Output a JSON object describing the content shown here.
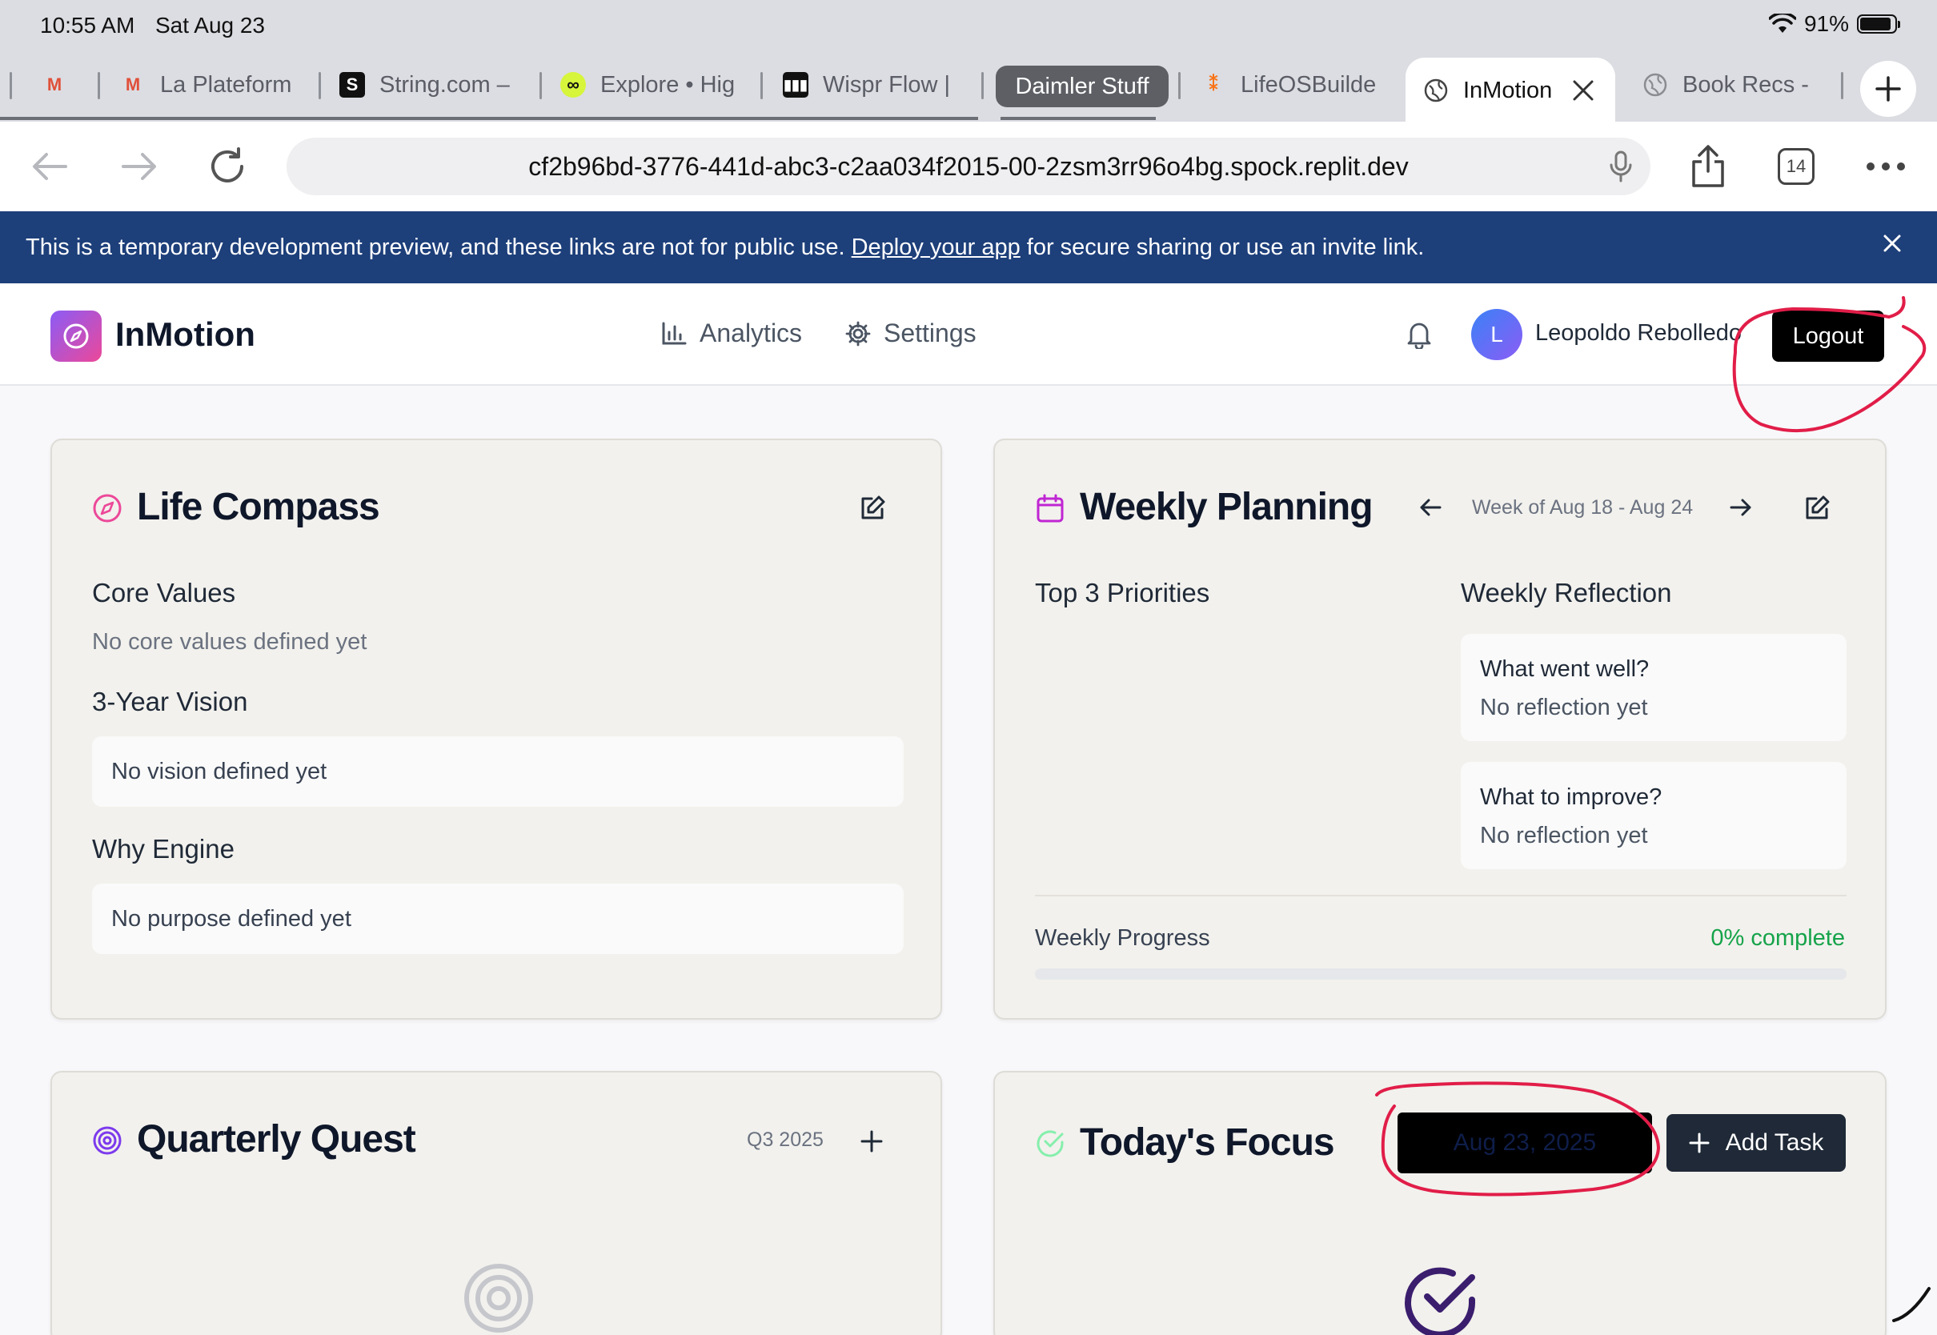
{
  "status_bar": {
    "time": "10:55 AM",
    "date": "Sat Aug 23",
    "battery": "91%",
    "battery_level": 0.91
  },
  "tabs": [
    {
      "label": "",
      "icon": "m-logo-icon"
    },
    {
      "label": "La Plateform",
      "icon": "m-logo-icon"
    },
    {
      "label": "String.com –",
      "icon": "s-logo-icon"
    },
    {
      "label": "Explore • Hig",
      "icon": "explore-logo-icon"
    },
    {
      "label": "Wispr Flow |",
      "icon": "wispr-logo-icon"
    },
    {
      "label": "LifeOSBuilde",
      "icon": "lifeos-logo-icon"
    },
    {
      "label": "InMotion",
      "icon": "globe-icon",
      "active": true
    },
    {
      "label": "Book Recs -",
      "icon": "globe-icon"
    }
  ],
  "tab_group": {
    "label": "Daimler Stuff"
  },
  "browser": {
    "url": "cf2b96bd-3776-441d-abc3-c2aa034f2015-00-2zsm3rr96o4bg.spock.replit.dev",
    "tab_count": "14"
  },
  "banner": {
    "text_before": "This is a temporary development preview, and these links are not for public use.",
    "link": "Deploy your app",
    "text_after": "for secure sharing or use an invite link."
  },
  "header": {
    "app_name": "InMotion",
    "nav": {
      "analytics": "Analytics",
      "settings": "Settings"
    },
    "avatar_initial": "L",
    "user_name": "Leopoldo Rebolledo",
    "logout": "Logout"
  },
  "life_compass": {
    "title": "Life Compass",
    "core_values_label": "Core Values",
    "core_values_empty": "No core values defined yet",
    "vision_label": "3-Year Vision",
    "vision_empty": "No vision defined yet",
    "why_label": "Why Engine",
    "why_empty": "No purpose defined yet"
  },
  "weekly_planning": {
    "title": "Weekly Planning",
    "week_range": "Week of Aug 18 - Aug 24",
    "priorities_label": "Top 3 Priorities",
    "reflection_label": "Weekly Reflection",
    "went_well_label": "What went well?",
    "went_well_text": "No reflection yet",
    "improve_label": "What to improve?",
    "improve_text": "No reflection yet",
    "progress_label": "Weekly Progress",
    "progress_text": "0% complete",
    "progress_value": 0
  },
  "quarterly_quest": {
    "title": "Quarterly Quest",
    "quarter": "Q3 2025"
  },
  "todays_focus": {
    "title": "Today's Focus",
    "date": "Aug 23, 2025",
    "add_task": "Add Task"
  },
  "colors": {
    "banner": "#1d3f7a",
    "card_bg": "#f2f1ed",
    "accent_pink": "#ec4899",
    "accent_purple": "#7c3aed",
    "success_green": "#22c55e",
    "annotation_red": "#e11d48"
  }
}
